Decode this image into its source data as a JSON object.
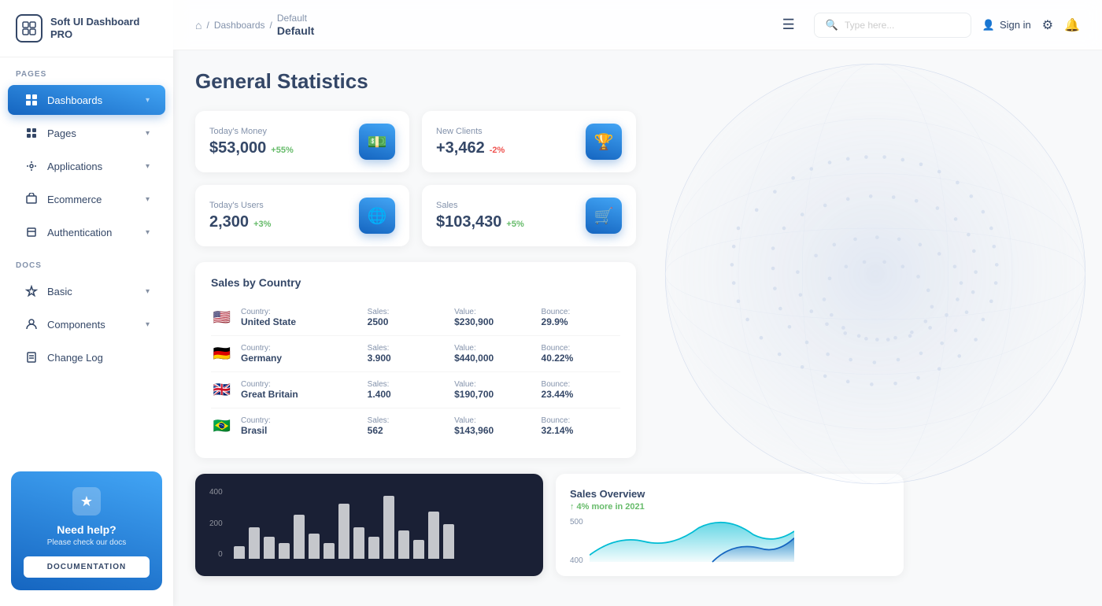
{
  "sidebar": {
    "logo": {
      "icon": "⊞",
      "text": "Soft UI Dashboard PRO"
    },
    "pages_label": "PAGES",
    "docs_label": "DOCS",
    "items_pages": [
      {
        "id": "dashboards",
        "label": "Dashboards",
        "icon": "⊡",
        "active": true,
        "has_chevron": true
      },
      {
        "id": "pages",
        "label": "Pages",
        "icon": "📊",
        "active": false,
        "has_chevron": true
      },
      {
        "id": "applications",
        "label": "Applications",
        "icon": "🔧",
        "active": false,
        "has_chevron": true
      },
      {
        "id": "ecommerce",
        "label": "Ecommerce",
        "icon": "🏷",
        "active": false,
        "has_chevron": true
      },
      {
        "id": "authentication",
        "label": "Authentication",
        "icon": "📄",
        "active": false,
        "has_chevron": true
      }
    ],
    "items_docs": [
      {
        "id": "basic",
        "label": "Basic",
        "icon": "🚀",
        "active": false,
        "has_chevron": true
      },
      {
        "id": "components",
        "label": "Components",
        "icon": "👤",
        "active": false,
        "has_chevron": true
      },
      {
        "id": "changelog",
        "label": "Change Log",
        "icon": "📋",
        "active": false,
        "has_chevron": false
      }
    ],
    "help": {
      "star_icon": "★",
      "title": "Need help?",
      "subtitle": "Please check our docs",
      "button_label": "DOCUMENTATION"
    }
  },
  "topbar": {
    "home_icon": "⌂",
    "breadcrumb_sep": "/",
    "breadcrumb_parent": "Dashboards",
    "breadcrumb_current": "Default",
    "page_title_display": "Default",
    "menu_icon": "☰",
    "search_placeholder": "Type here...",
    "signin_label": "Sign in",
    "settings_icon": "⚙",
    "bell_icon": "🔔"
  },
  "main": {
    "page_title": "General Statistics",
    "stats": [
      {
        "id": "money",
        "label": "Today's Money",
        "value": "$53,000",
        "change": "+55%",
        "change_type": "positive",
        "icon": "💵"
      },
      {
        "id": "clients",
        "label": "New Clients",
        "value": "+3,462",
        "change": "-2%",
        "change_type": "negative",
        "icon": "🏆"
      },
      {
        "id": "users",
        "label": "Today's Users",
        "value": "2,300",
        "change": "+3%",
        "change_type": "positive",
        "icon": "🌐"
      },
      {
        "id": "sales",
        "label": "Sales",
        "value": "$103,430",
        "change": "+5%",
        "change_type": "positive",
        "icon": "🛒"
      }
    ],
    "sales_by_country": {
      "title": "Sales by Country",
      "columns": [
        "Country:",
        "Sales:",
        "Value:",
        "Bounce:"
      ],
      "rows": [
        {
          "flag": "🇺🇸",
          "country": "United State",
          "sales": "2500",
          "value": "$230,900",
          "bounce": "29.9%"
        },
        {
          "flag": "🇩🇪",
          "country": "Germany",
          "sales": "3.900",
          "value": "$440,000",
          "bounce": "40.22%"
        },
        {
          "flag": "🇬🇧",
          "country": "Great Britain",
          "sales": "1.400",
          "value": "$190,700",
          "bounce": "23.44%"
        },
        {
          "flag": "🇧🇷",
          "country": "Brasil",
          "sales": "562",
          "value": "$143,960",
          "bounce": "32.14%"
        }
      ]
    },
    "bar_chart": {
      "y_labels": [
        "400",
        "200",
        "0"
      ],
      "bars": [
        8,
        20,
        14,
        10,
        28,
        16,
        10,
        35,
        20,
        14,
        40,
        18,
        12,
        30,
        22
      ]
    },
    "sales_overview": {
      "title": "Sales Overview",
      "subtitle": "↑ 4% more in 2021",
      "y_labels": [
        "500",
        "400"
      ]
    }
  }
}
